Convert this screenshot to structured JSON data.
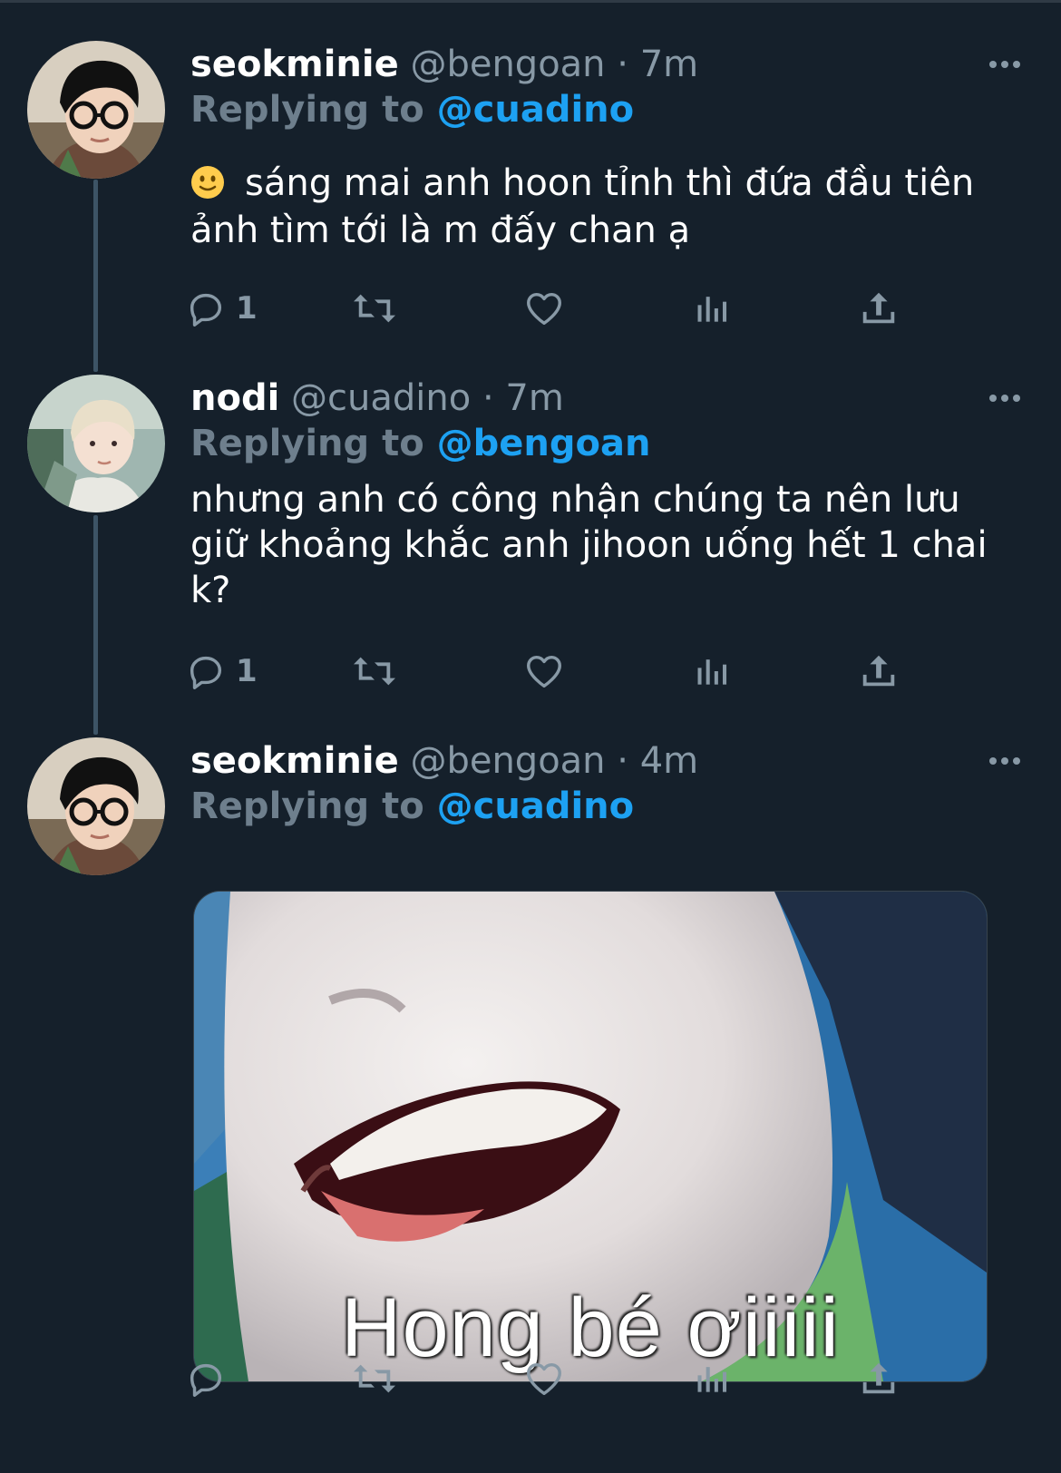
{
  "tweets": [
    {
      "name": "seokminie",
      "handle": "@bengoan",
      "separator": "·",
      "time": "7m",
      "replying_prefix": "Replying to",
      "replying_to": "@cuadino",
      "text_line1": "sáng mai anh hoon tỉnh thì đứa đầu tiên",
      "text_line2": "ảnh tìm tới là m đấy chan ạ",
      "emoji": "slightly-smiling-face-icon",
      "reply_count": "1"
    },
    {
      "name": "nodi",
      "handle": "@cuadino",
      "separator": "·",
      "time": "7m",
      "replying_prefix": "Replying to",
      "replying_to": "@bengoan",
      "text_line1": "nhưng anh có công nhận chúng ta nên lưu",
      "text_line2": "giữ khoảng khắc anh jihoon uống hết 1 chai",
      "text_line3": "k?",
      "reply_count": "1"
    },
    {
      "name": "seokminie",
      "handle": "@bengoan",
      "separator": "·",
      "time": "4m",
      "replying_prefix": "Replying to",
      "replying_to": "@cuadino",
      "media_caption": "Hong bé ơiiiii",
      "reply_count": ""
    }
  ],
  "icons": [
    "reply-icon",
    "retweet-icon",
    "like-icon",
    "analytics-icon",
    "share-icon",
    "more-icon"
  ],
  "colors": {
    "background": "#15202b",
    "mention": "#1da1f2",
    "secondary": "#8899a6"
  }
}
